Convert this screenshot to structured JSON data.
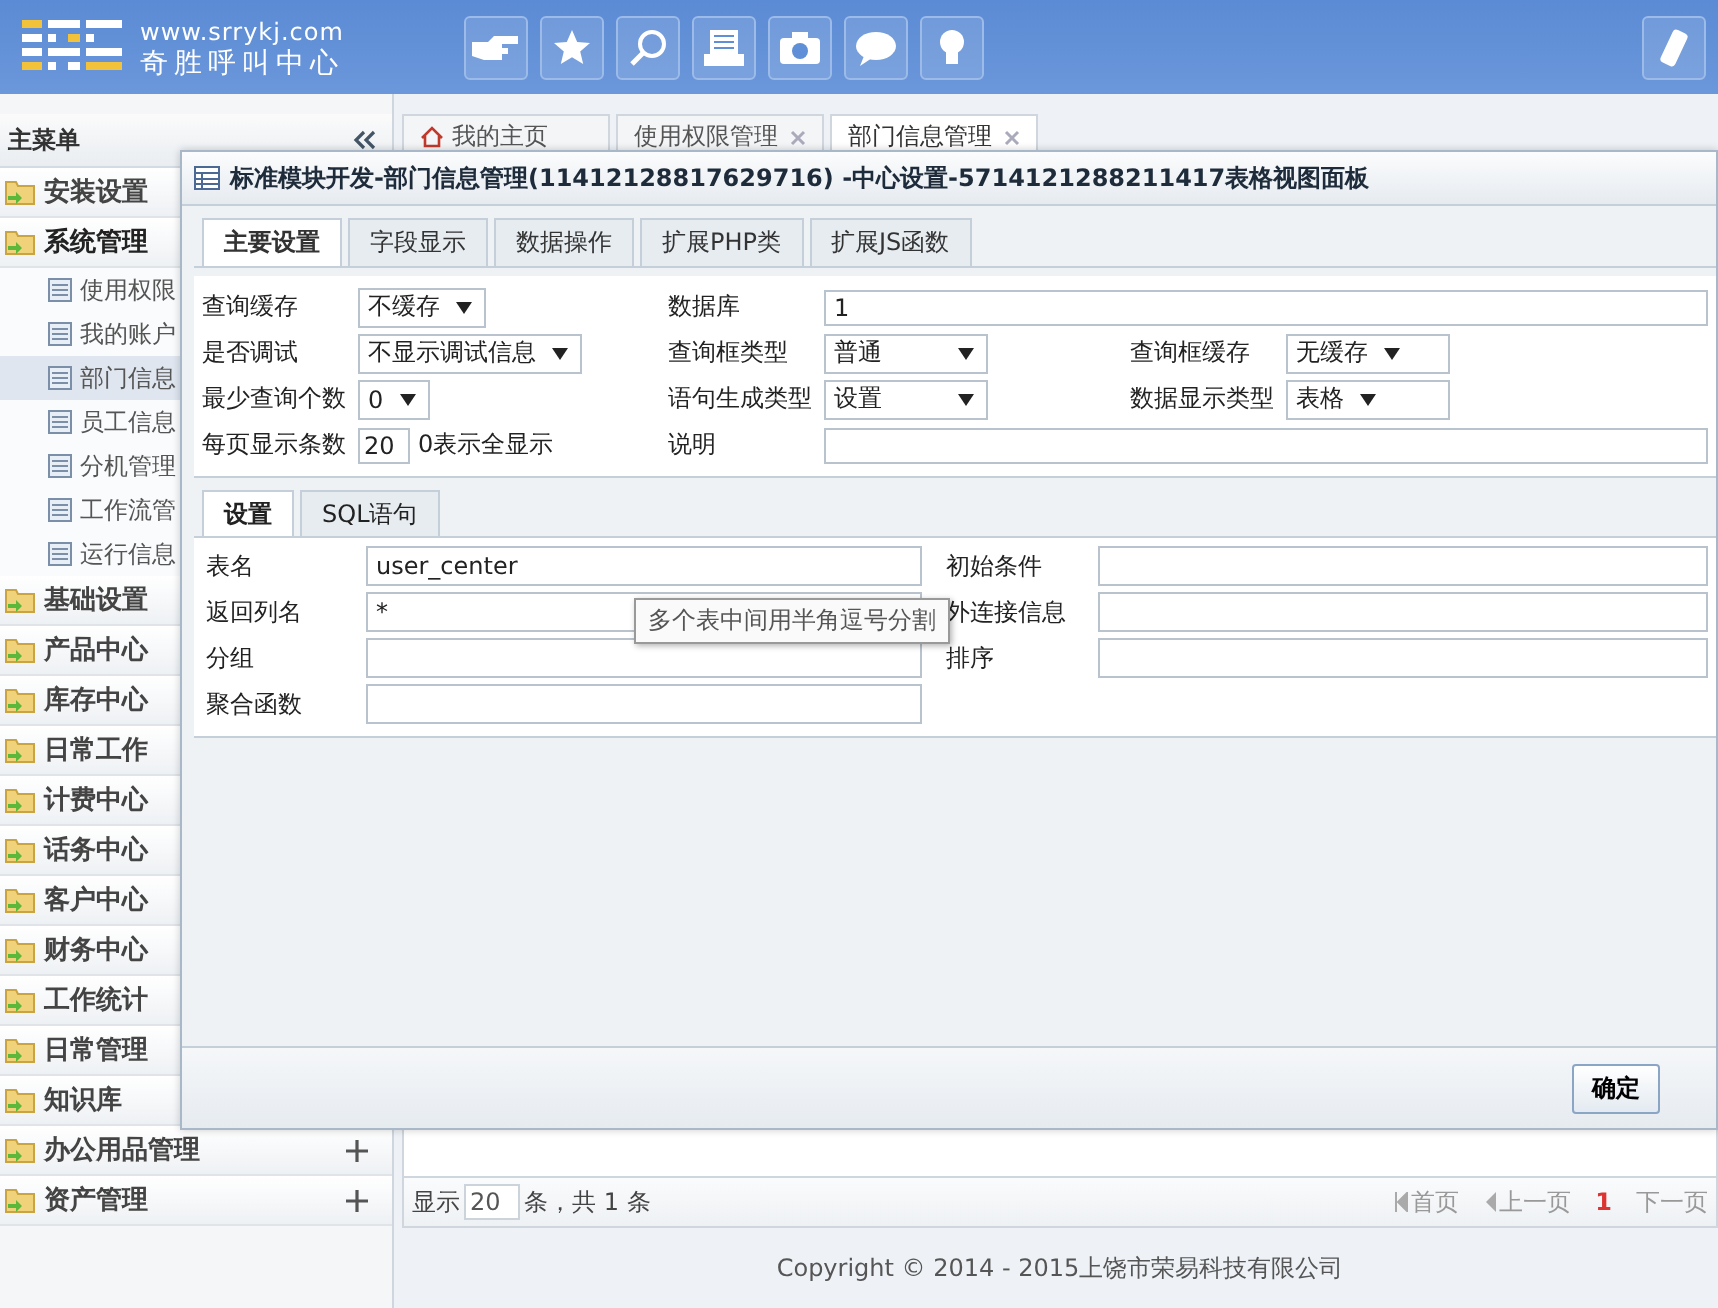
{
  "header": {
    "site": "www.srrykj.com",
    "name": "奇胜呼叫中心"
  },
  "sidebar": {
    "title": "主菜单",
    "items": [
      {
        "label": "安装设置",
        "kind": "group",
        "expanded": false
      },
      {
        "label": "系统管理",
        "kind": "group",
        "expanded": true,
        "children": [
          {
            "label": "使用权限",
            "selected": false
          },
          {
            "label": "我的账户",
            "selected": false
          },
          {
            "label": "部门信息",
            "selected": true
          },
          {
            "label": "员工信息",
            "selected": false
          },
          {
            "label": "分机管理",
            "selected": false
          },
          {
            "label": "工作流管",
            "selected": false
          },
          {
            "label": "运行信息",
            "selected": false
          }
        ]
      },
      {
        "label": "基础设置",
        "kind": "group",
        "expanded": false
      },
      {
        "label": "产品中心",
        "kind": "group",
        "expanded": false
      },
      {
        "label": "库存中心",
        "kind": "group",
        "expanded": false
      },
      {
        "label": "日常工作",
        "kind": "group",
        "expanded": false
      },
      {
        "label": "计费中心",
        "kind": "group",
        "expanded": false
      },
      {
        "label": "话务中心",
        "kind": "group",
        "expanded": false
      },
      {
        "label": "客户中心",
        "kind": "group",
        "expanded": false
      },
      {
        "label": "财务中心",
        "kind": "group",
        "expanded": false
      },
      {
        "label": "工作统计",
        "kind": "group",
        "expanded": false
      },
      {
        "label": "日常管理",
        "kind": "group",
        "expanded": false
      },
      {
        "label": "知识库",
        "kind": "group",
        "expanded": false
      },
      {
        "label": "办公用品管理",
        "kind": "group_toggle",
        "expanded": false
      },
      {
        "label": "资产管理",
        "kind": "group_toggle",
        "expanded": false
      }
    ]
  },
  "tabs": [
    {
      "label": "我的主页",
      "kind": "home",
      "selected": false
    },
    {
      "label": "使用权限管理",
      "kind": "closable",
      "selected": false
    },
    {
      "label": "部门信息管理",
      "kind": "closable",
      "selected": true
    }
  ],
  "pager": {
    "show": "显示",
    "page_size": "20",
    "summary": "条，共 1 条",
    "links": [
      {
        "label": "首页",
        "kind": "first",
        "disabled": true
      },
      {
        "label": "上一页",
        "kind": "prev",
        "disabled": true
      },
      {
        "label": "1",
        "kind": "current"
      },
      {
        "label": "下一页",
        "kind": "next",
        "disabled": true
      }
    ]
  },
  "footer": "Copyright © 2014 - 2015上饶市荣易科技有限公司",
  "dialog": {
    "title": "标准模块开发-部门信息管理(11412128817629716) -中心设置-5714121288211417表格视图面板",
    "tabs": [
      {
        "label": "主要设置",
        "selected": true
      },
      {
        "label": "字段显示",
        "selected": false
      },
      {
        "label": "数据操作",
        "selected": false
      },
      {
        "label": "扩展PHP类",
        "selected": false
      },
      {
        "label": "扩展JS函数",
        "selected": false
      }
    ],
    "rows": [
      [
        {
          "label": "查询缓存",
          "kind": "select",
          "value": "不缓存"
        },
        {
          "label": "数据库",
          "kind": "long_field",
          "value": "1"
        }
      ],
      [
        {
          "label": "是否调试",
          "kind": "select",
          "value": "不显示调试信息"
        },
        {
          "label": "查询框类型",
          "kind": "select",
          "value": "普通"
        },
        {
          "label": "查询框缓存",
          "kind": "select",
          "value": "无缓存"
        }
      ],
      [
        {
          "label": "最少查询个数",
          "kind": "select",
          "value": "0"
        },
        {
          "label": "语句生成类型",
          "kind": "select",
          "value": "设置"
        },
        {
          "label": "数据显示类型",
          "kind": "select",
          "value": "表格"
        }
      ],
      [
        {
          "label": "每页显示条数",
          "kind": "short_field",
          "value": "20",
          "note": "0表示全显示"
        },
        {
          "label": "说明",
          "kind": "long_field"
        }
      ]
    ],
    "subtabs": [
      {
        "label": "设置",
        "selected": true
      },
      {
        "label": "SQL语句",
        "selected": false
      }
    ],
    "sql_fields": [
      {
        "label": "表名",
        "value": "user_center"
      },
      {
        "label": "初始条件"
      },
      {
        "label": "返回列名",
        "value": "*"
      },
      {
        "label": "外连接信息"
      },
      {
        "label": "分组"
      },
      {
        "label": "排序"
      },
      {
        "label": "聚合函数"
      }
    ],
    "tooltip": "多个表中间用半角逗号分割",
    "ok": "确定"
  }
}
